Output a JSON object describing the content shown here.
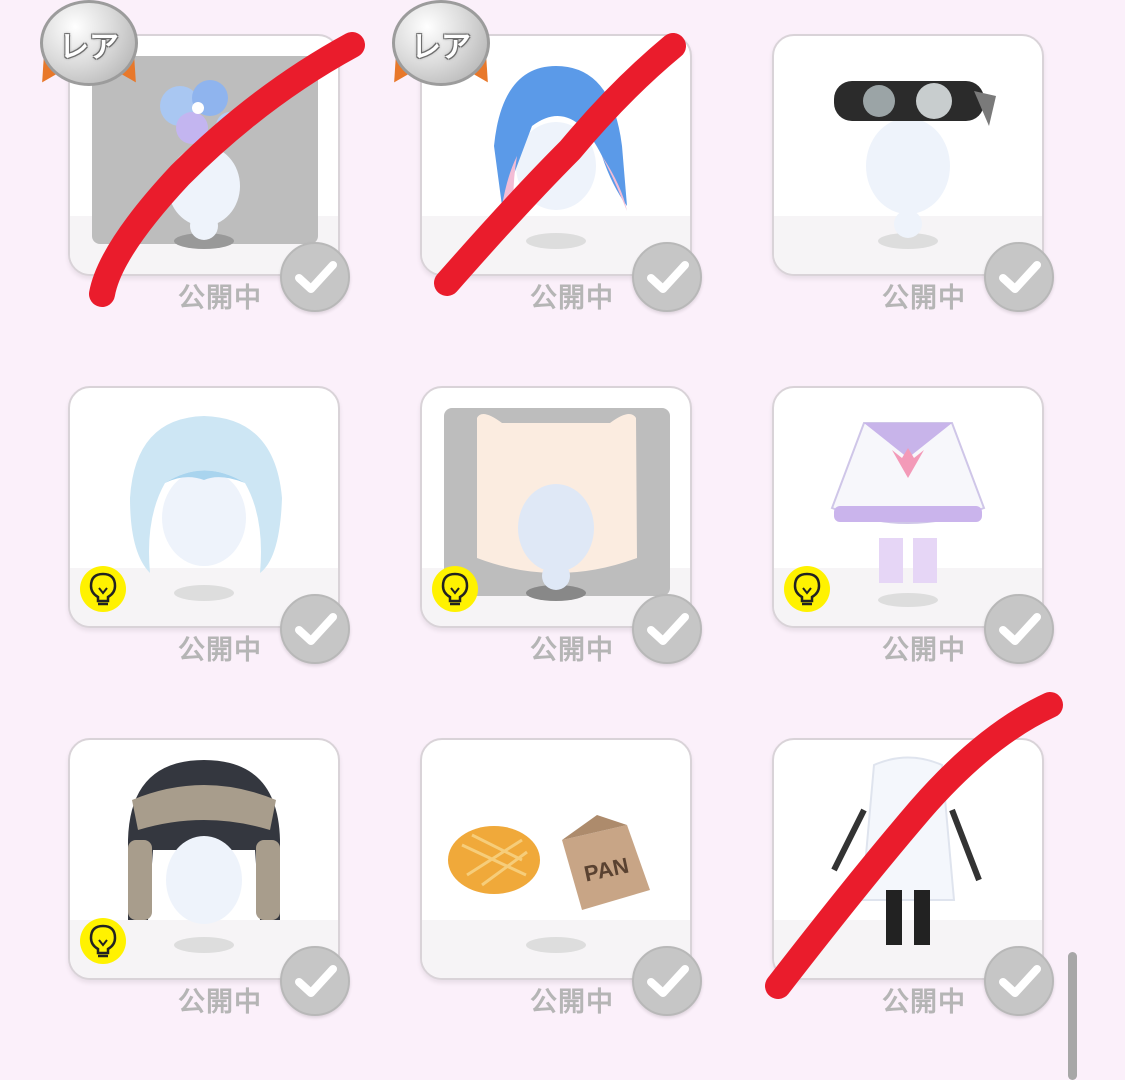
{
  "status_label": "公開中",
  "rare_badge": "レア",
  "colors": {
    "background": "#fbf0fa",
    "strike": "#ea1c2c",
    "hint_badge": "#fff200",
    "check_circle": "#c6c6c6"
  },
  "items": [
    {
      "name": "blue flower hair accessory",
      "rare": true,
      "hint": false,
      "gray_bg": true,
      "struck": true
    },
    {
      "name": "blue pink wavy hair",
      "rare": true,
      "hint": false,
      "gray_bg": false,
      "struck": true
    },
    {
      "name": "goggles hat",
      "rare": false,
      "hint": false,
      "gray_bg": false,
      "struck": false
    },
    {
      "name": "pale blue fluffy hair",
      "rare": false,
      "hint": true,
      "gray_bg": false,
      "struck": false
    },
    {
      "name": "cream cat ear hood",
      "rare": false,
      "hint": true,
      "gray_bg": true,
      "struck": false
    },
    {
      "name": "sailor dress outfit",
      "rare": false,
      "hint": true,
      "gray_bg": false,
      "struck": false
    },
    {
      "name": "fur trapper hat",
      "rare": false,
      "hint": true,
      "gray_bg": false,
      "struck": false
    },
    {
      "name": "melon bread and bag",
      "rare": false,
      "hint": false,
      "gray_bg": false,
      "struck": false
    },
    {
      "name": "white coat outfit",
      "rare": false,
      "hint": false,
      "gray_bg": false,
      "struck": true
    }
  ],
  "bag_label": "PAN",
  "icons": {
    "check": "checkmark-icon",
    "hint": "lightbulb-icon",
    "rare": "rare-medal-icon"
  }
}
